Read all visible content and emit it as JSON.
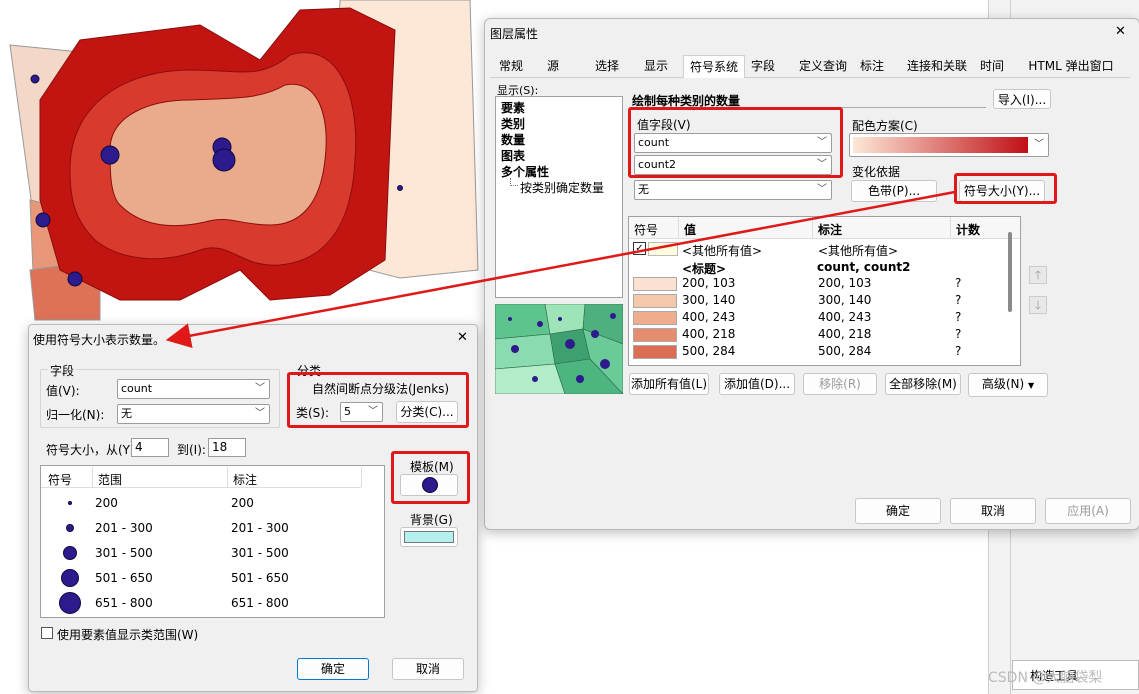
{
  "map": {
    "colors": [
      "#fce4d2",
      "#f0b090",
      "#e07a60",
      "#c41a14",
      "#dd3a2c"
    ]
  },
  "props": {
    "title": "图层属性",
    "close": "✕",
    "tabs": [
      "常规",
      "源",
      "选择",
      "显示",
      "符号系统",
      "字段",
      "定义查询",
      "标注",
      "连接和关联",
      "时间",
      "HTML 弹出窗口"
    ],
    "show_label": "显示(S):",
    "tree": [
      "要素",
      "类别",
      "数量",
      "图表",
      "多个属性",
      "按类别确定数量"
    ],
    "heading": "绘制每种类别的数量",
    "import_btn": "导入(I)...",
    "value_field_label": "值字段(V)",
    "field1": "count",
    "field2": "count2",
    "none_val": "无",
    "color_scheme_label": "配色方案(C)",
    "vary_label": "变化依据",
    "color_ramp_btn": "色带(P)...",
    "symbol_size_btn": "符号大小(Y)...",
    "table": {
      "headers": [
        "符号",
        "值",
        "标注",
        "计数"
      ],
      "other_value": "<其他所有值>",
      "other_label": "<其他所有值>",
      "heading_value": "<标题>",
      "heading_label": "count, count2",
      "rows": [
        {
          "value": "200, 103",
          "label": "200, 103",
          "count": "?",
          "color": "#fbe1cf"
        },
        {
          "value": "300, 140",
          "label": "300, 140",
          "count": "?",
          "color": "#f5c7ab"
        },
        {
          "value": "400, 243",
          "label": "400, 243",
          "count": "?",
          "color": "#efad8e"
        },
        {
          "value": "400, 218",
          "label": "400, 218",
          "count": "?",
          "color": "#e68d70"
        },
        {
          "value": "500, 284",
          "label": "500, 284",
          "count": "?",
          "color": "#dc6d55"
        }
      ]
    },
    "buttons": [
      "添加所有值(L)",
      "添加值(D)...",
      "移除(R)",
      "全部移除(M)",
      "高级(N)"
    ],
    "ok": "确定",
    "cancel": "取消",
    "apply": "应用(A)"
  },
  "size_dialog": {
    "title": "使用符号大小表示数量。",
    "close": "✕",
    "field_group": "字段",
    "value_label": "值(V):",
    "value": "count",
    "normalize_label": "归一化(N):",
    "normalize": "无",
    "classify_group": "分类",
    "method": "自然间断点分级法(Jenks)",
    "classes_label": "类(S):",
    "classes": "5",
    "classify_btn": "分类(C)...",
    "size_from_label": "符号大小，从(Y)",
    "size_from": "4",
    "size_to_label": "到(I):",
    "size_to": "18",
    "headers": [
      "符号",
      "范围",
      "标注"
    ],
    "rows": [
      {
        "range": "200",
        "label": "200"
      },
      {
        "range": "201 - 300",
        "label": "201 - 300"
      },
      {
        "range": "301 - 500",
        "label": "301 - 500"
      },
      {
        "range": "501 - 650",
        "label": "501 - 650"
      },
      {
        "range": "651 - 800",
        "label": "651 - 800"
      }
    ],
    "template_label": "模板(M)",
    "background_label": "背景(G)",
    "checkbox_label": "使用要素值显示类范围(W)",
    "ok": "确定",
    "cancel": "取消"
  },
  "bottom_right": {
    "label": "构造工具",
    "watermark": "CSDN @大脑袋梨"
  }
}
